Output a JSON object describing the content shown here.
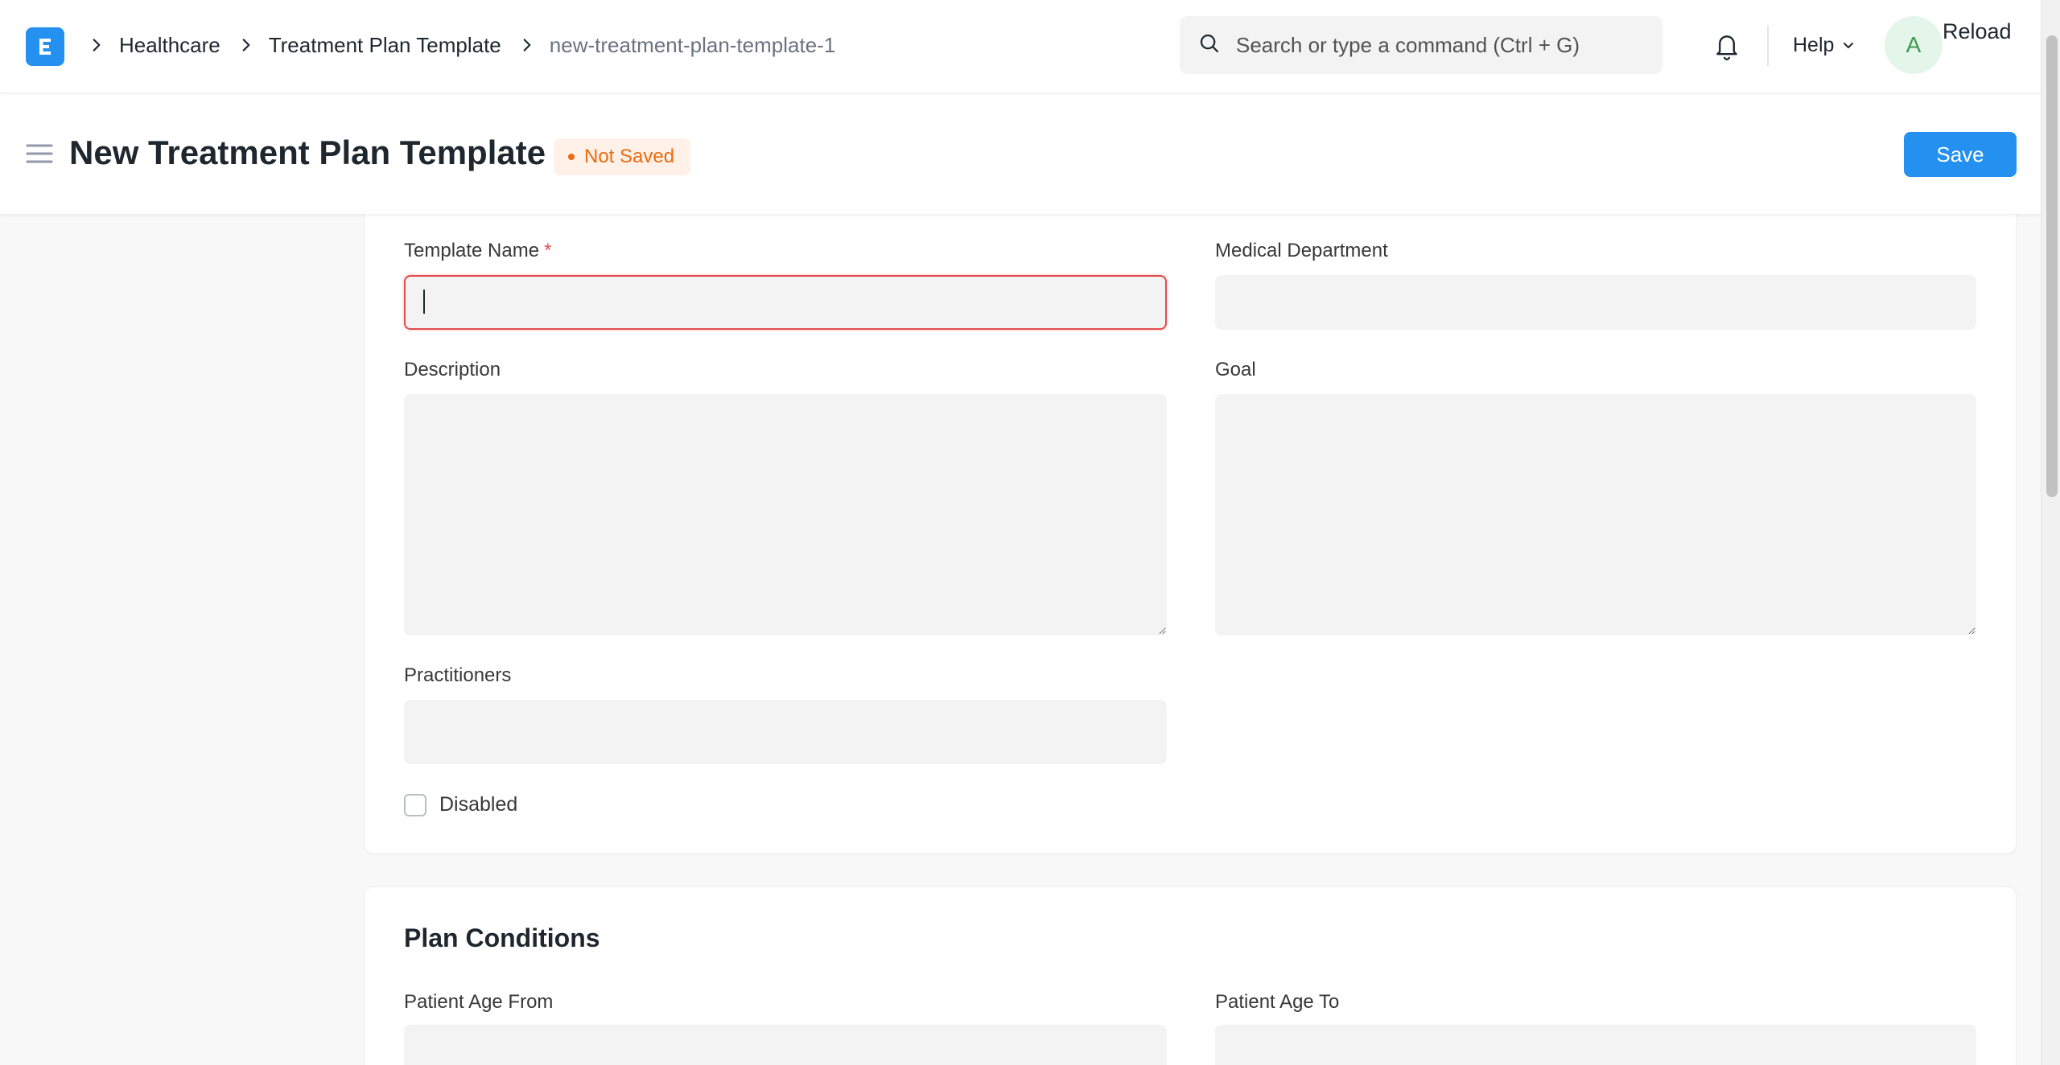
{
  "navbar": {
    "breadcrumbs": [
      "Healthcare",
      "Treatment Plan Template"
    ],
    "current_doc": "new-treatment-plan-template-1",
    "search_placeholder": "Search or type a command (Ctrl + G)",
    "help_label": "Help",
    "avatar_initial": "A",
    "reload_label": "Reload",
    "icons": {
      "logo": "app-logo-icon",
      "chevron": "chevron-right-icon",
      "search": "search-icon",
      "bell": "bell-icon",
      "help_caret": "chevron-down-icon"
    }
  },
  "header": {
    "title": "New Treatment Plan Template",
    "status": "Not Saved",
    "save_label": "Save",
    "menu_icon": "hamburger-icon"
  },
  "form": {
    "template_name": {
      "label": "Template Name",
      "required_mark": "*",
      "value": ""
    },
    "medical_department": {
      "label": "Medical Department",
      "value": ""
    },
    "description": {
      "label": "Description",
      "value": ""
    },
    "goal": {
      "label": "Goal",
      "value": ""
    },
    "practitioners": {
      "label": "Practitioners",
      "value": ""
    },
    "disabled": {
      "label": "Disabled",
      "checked": false
    }
  },
  "plan_conditions": {
    "title": "Plan Conditions",
    "patient_age_from": {
      "label": "Patient Age From",
      "value": ""
    },
    "patient_age_to": {
      "label": "Patient Age To",
      "value": ""
    }
  },
  "colors": {
    "accent": "#2490ef",
    "status_orange": "#e86c13",
    "status_bg": "#fff1e7",
    "error_red": "#e24c4c"
  }
}
